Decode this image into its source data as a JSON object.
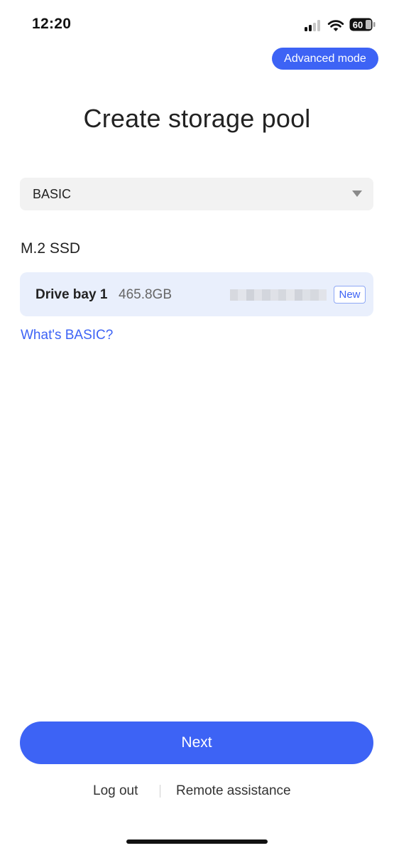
{
  "status_bar": {
    "time": "12:20",
    "battery_level": "60"
  },
  "header": {
    "advanced_mode_label": "Advanced mode"
  },
  "page": {
    "title": "Create storage pool"
  },
  "raid_select": {
    "selected_value": "BASIC"
  },
  "section": {
    "label": "M.2 SSD"
  },
  "drives": [
    {
      "name": "Drive bay 1",
      "capacity": "465.8GB",
      "badge": "New"
    }
  ],
  "help_link": {
    "label": "What's BASIC?"
  },
  "actions": {
    "next_label": "Next"
  },
  "footer": {
    "logout_label": "Log out",
    "remote_label": "Remote assistance"
  },
  "colors": {
    "accent": "#3d63f5",
    "card_bg": "#e9effc",
    "select_bg": "#f2f2f2"
  }
}
